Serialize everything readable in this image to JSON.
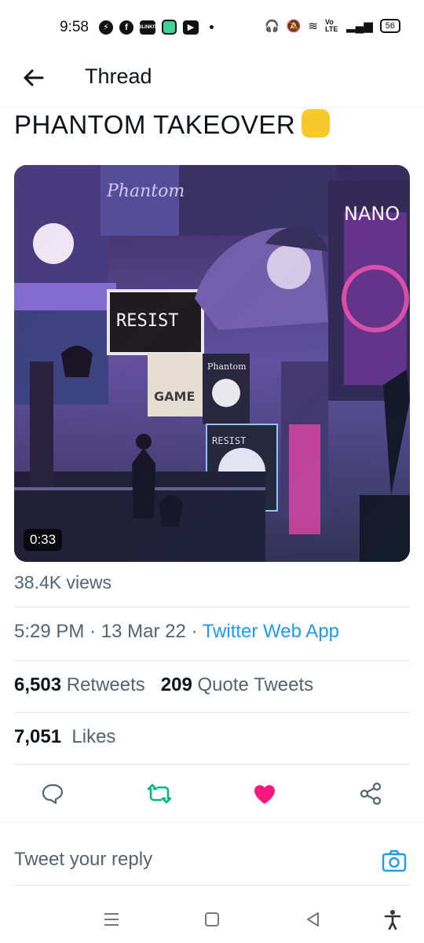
{
  "status_bar": {
    "time": "9:58",
    "app_icons": [
      "messenger-icon",
      "facebook-icon",
      "blinkit-icon",
      "chat-icon",
      "youtube-icon"
    ],
    "blinkit_text": "BLINKIT",
    "battery": "56",
    "network": "Vo LTE"
  },
  "header": {
    "title": "Thread"
  },
  "tweet": {
    "text": "PHANTOM TAKEOVER",
    "emoji": "raised-fist-emoji",
    "video_duration": "0:33",
    "views": "38.4K views",
    "time": "5:29 PM",
    "date": "13 Mar 22",
    "source": "Twitter Web App",
    "retweets_count": "6,503",
    "retweets_label": "Retweets",
    "quotes_count": "209",
    "quotes_label": "Quote Tweets",
    "likes_count": "7,051",
    "likes_label": "Likes"
  },
  "media_art_text": {
    "phantom_sign": "Phantom",
    "resist_sign": "RESIST",
    "game_sign": "GAME",
    "nano_sign": "NANO"
  },
  "actions": [
    "reply-icon",
    "retweet-icon",
    "like-icon",
    "share-icon"
  ],
  "reply": {
    "placeholder": "Tweet your reply"
  },
  "colors": {
    "accent": "#1d9bf0",
    "retweet": "#00ba7c",
    "like": "#f91880",
    "muted": "#536471"
  }
}
